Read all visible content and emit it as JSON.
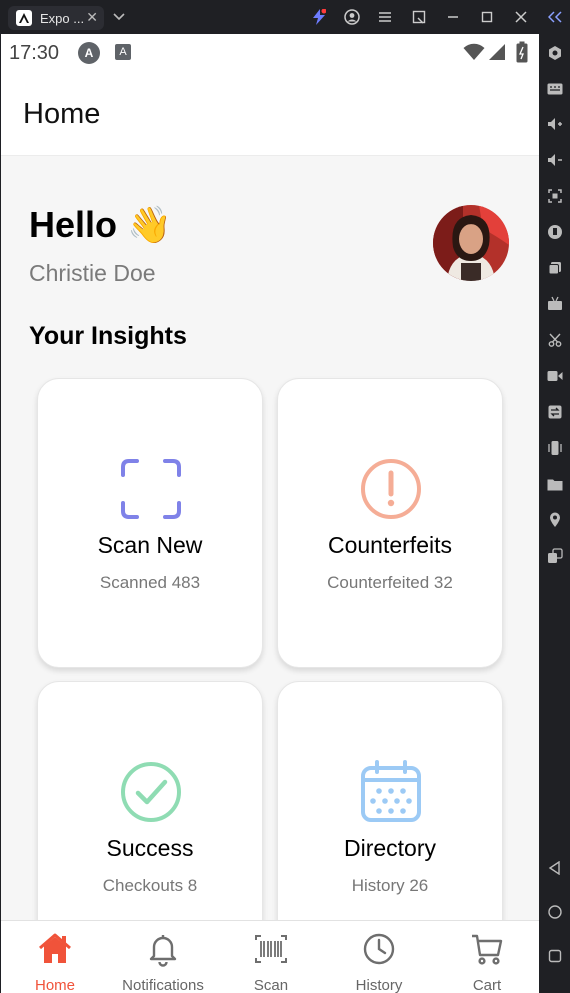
{
  "window": {
    "tab_title": "Expo ...",
    "tab_close": "✕"
  },
  "status_bar": {
    "time": "17:30",
    "badge_a": "A",
    "badge_b": "A"
  },
  "header": {
    "title": "Home"
  },
  "greeting": {
    "hello": "Hello",
    "wave": "👋",
    "name": "Christie Doe"
  },
  "insights": {
    "title": "Your Insights",
    "cards": [
      {
        "title": "Scan New",
        "subtitle": "Scanned 483",
        "icon": "scan-frame-icon",
        "color": "#7f82e8"
      },
      {
        "title": "Counterfeits",
        "subtitle": "Counterfeited 32",
        "icon": "alert-circle-icon",
        "color": "#f5ad96"
      },
      {
        "title": "Success",
        "subtitle": "Checkouts 8",
        "icon": "check-circle-icon",
        "color": "#8fdcb3"
      },
      {
        "title": "Directory",
        "subtitle": "History 26",
        "icon": "calendar-icon",
        "color": "#9ccaf5"
      }
    ]
  },
  "bottom_nav": {
    "active_color": "#f0533a",
    "items": [
      {
        "label": "Home",
        "icon": "home-icon",
        "active": true
      },
      {
        "label": "Notifications",
        "icon": "bell-icon",
        "active": false
      },
      {
        "label": "Scan",
        "icon": "barcode-icon",
        "active": false
      },
      {
        "label": "History",
        "icon": "clock-icon",
        "active": false
      },
      {
        "label": "Cart",
        "icon": "cart-icon",
        "active": false
      }
    ]
  }
}
